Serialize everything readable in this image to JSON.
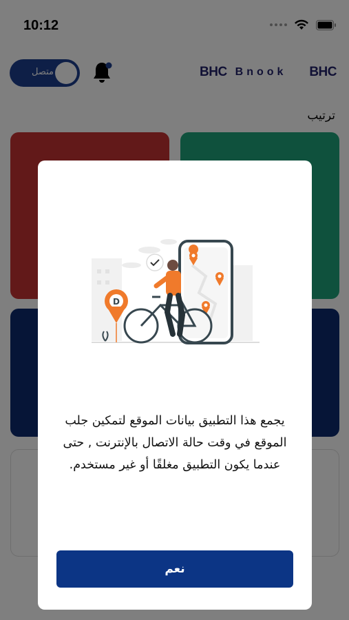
{
  "status_bar": {
    "time": "10:12",
    "icons": [
      "signal-dots-icon",
      "wifi-icon",
      "battery-icon"
    ]
  },
  "header": {
    "toggle_label": "متصل",
    "toggle_on": true,
    "bell_badge_color": "#1d3f8e",
    "logo_left_mark": "BHC",
    "logo_left_text": "Bnook",
    "logo_right_mark": "BHC"
  },
  "section": {
    "title": "ترتيب"
  },
  "tiles": {
    "colors": [
      "#c43232",
      "#1fa37a",
      "#0d2b6e",
      "#0d2b6e",
      "#ffffff",
      "#ffffff"
    ]
  },
  "modal": {
    "illustration_icon": "bike-delivery-location-illustration",
    "pin_letter": "D",
    "message": "يجمع هذا التطبيق بيانات الموقع لتمكين جلب الموقع في وقت حالة الاتصال بالإنترنت , حتى عندما يكون التطبيق مغلقًا أو غير مستخدم.",
    "confirm_label": "نعم",
    "accent_color": "#0c3585",
    "illustration_accent": "#f07a2b"
  }
}
